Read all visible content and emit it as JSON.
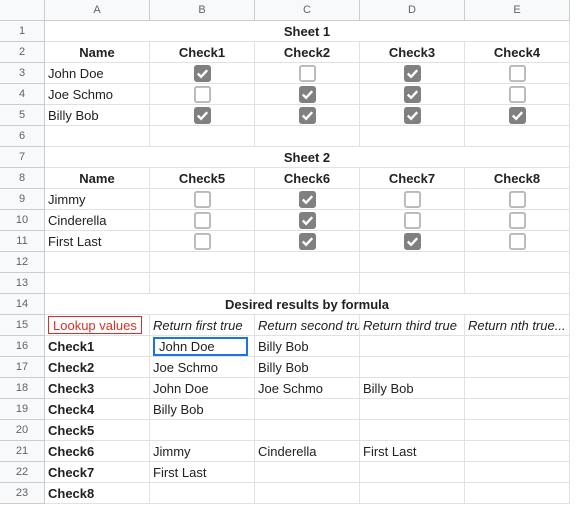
{
  "columns": [
    "A",
    "B",
    "C",
    "D",
    "E"
  ],
  "rows": [
    "1",
    "2",
    "3",
    "4",
    "5",
    "6",
    "7",
    "8",
    "9",
    "10",
    "11",
    "12",
    "13",
    "14",
    "15",
    "16",
    "17",
    "18",
    "19",
    "20",
    "21",
    "22",
    "23"
  ],
  "sheet1": {
    "title": "Sheet 1",
    "header_name": "Name",
    "checks": [
      "Check1",
      "Check2",
      "Check3",
      "Check4"
    ],
    "rows": [
      {
        "name": "John Doe",
        "c": [
          true,
          false,
          true,
          false
        ]
      },
      {
        "name": "Joe Schmo",
        "c": [
          false,
          true,
          true,
          false
        ]
      },
      {
        "name": "Billy Bob",
        "c": [
          true,
          true,
          true,
          true
        ]
      }
    ]
  },
  "sheet2": {
    "title": "Sheet 2",
    "header_name": "Name",
    "checks": [
      "Check5",
      "Check6",
      "Check7",
      "Check8"
    ],
    "rows": [
      {
        "name": "Jimmy",
        "c": [
          false,
          true,
          false,
          false
        ]
      },
      {
        "name": "Cinderella",
        "c": [
          false,
          true,
          false,
          false
        ]
      },
      {
        "name": "First Last",
        "c": [
          false,
          true,
          true,
          false
        ]
      }
    ]
  },
  "results": {
    "title": "Desired results by formula",
    "lookup_label": "Lookup values",
    "cols": [
      "Return first true",
      "Return second true",
      "Return third true",
      "Return nth true..."
    ],
    "rows": [
      {
        "k": "Check1",
        "v": [
          "John Doe",
          "Billy Bob",
          "",
          ""
        ]
      },
      {
        "k": "Check2",
        "v": [
          "Joe Schmo",
          "Billy Bob",
          "",
          ""
        ]
      },
      {
        "k": "Check3",
        "v": [
          "John Doe",
          "Joe Schmo",
          "Billy Bob",
          ""
        ]
      },
      {
        "k": "Check4",
        "v": [
          "Billy Bob",
          "",
          "",
          ""
        ]
      },
      {
        "k": "Check5",
        "v": [
          "",
          "",
          "",
          ""
        ]
      },
      {
        "k": "Check6",
        "v": [
          "Jimmy",
          "Cinderella",
          "First Last",
          ""
        ]
      },
      {
        "k": "Check7",
        "v": [
          "First Last",
          "",
          "",
          ""
        ]
      },
      {
        "k": "Check8",
        "v": [
          "",
          "",
          "",
          ""
        ]
      }
    ]
  }
}
